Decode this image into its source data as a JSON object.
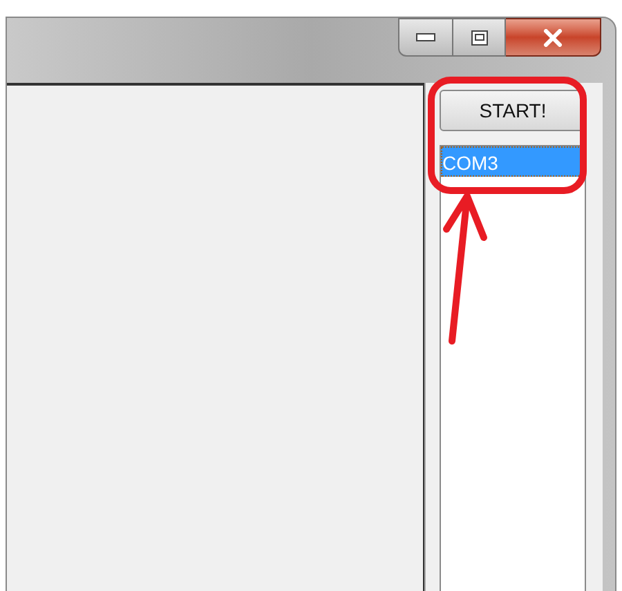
{
  "toolbar": {
    "button": "START!"
  },
  "port_list": {
    "items": [
      {
        "label": "COM3",
        "selected": true
      }
    ]
  }
}
